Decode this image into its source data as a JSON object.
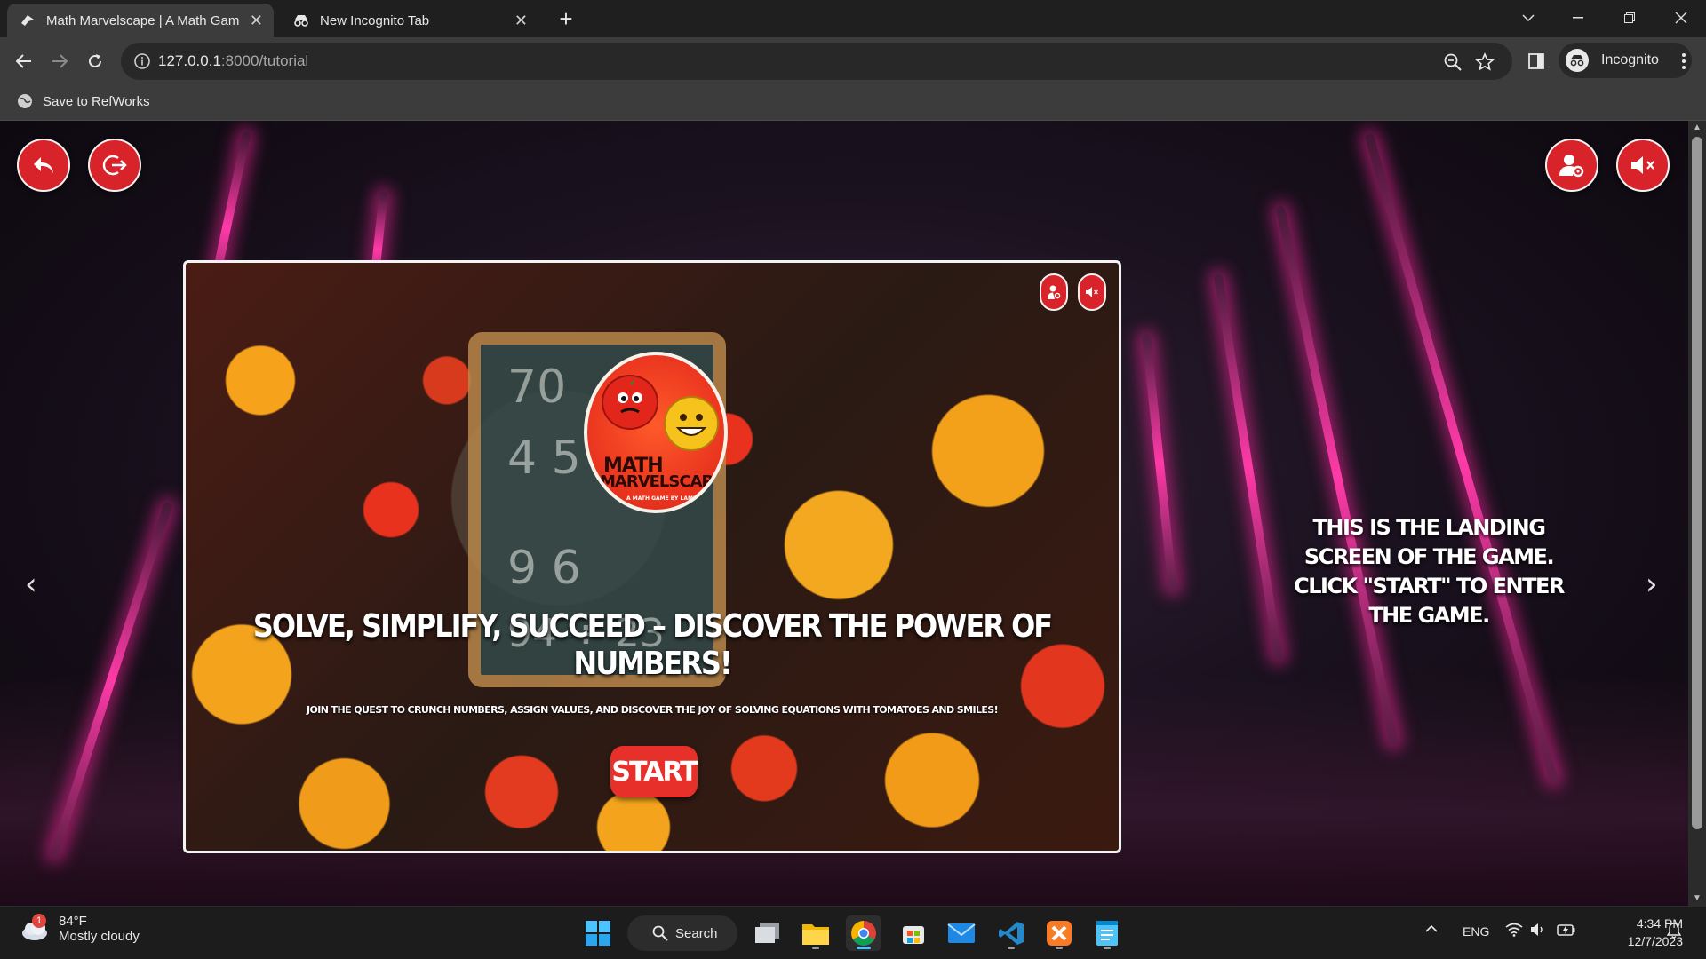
{
  "browser": {
    "tabs": [
      {
        "title": "Math Marvelscape | A Math Gam",
        "active": true
      },
      {
        "title": "New Incognito Tab",
        "active": false
      }
    ],
    "new_tab_label": "+",
    "url_host": "127.0.0.1",
    "url_rest": ":8000/tutorial",
    "profile_label": "Incognito",
    "bookmark": "Save to RefWorks"
  },
  "page": {
    "headline": "SOLVE, SIMPLIFY, SUCCEED – DISCOVER THE POWER OF NUMBERS!",
    "subline": "JOIN THE QUEST TO CRUNCH NUMBERS, ASSIGN VALUES, AND DISCOVER THE JOY OF SOLVING EQUATIONS WITH TOMATOES AND SMILES!",
    "start_label": "START",
    "logo_line1": "MATH",
    "logo_line2": "MARVELSCAPE",
    "logo_line3": "A MATH GAME BY LAMBESH",
    "chalk_lines": [
      "70",
      "4 5",
      "9 6",
      "94 ÷ 23"
    ],
    "caption": "THIS IS THE LANDING SCREEN OF THE GAME. CLICK \"START\" TO ENTER THE GAME.",
    "prev_arrow": "‹",
    "next_arrow": "›"
  },
  "taskbar": {
    "weather_temp": "84°F",
    "weather_cond": "Mostly cloudy",
    "weather_badge": "1",
    "search_label": "Search",
    "lang": "ENG",
    "time": "4:34 PM",
    "date": "12/7/2023"
  },
  "colors": {
    "accent_red": "#d8232a",
    "neon_pink": "#ff3aa8"
  }
}
